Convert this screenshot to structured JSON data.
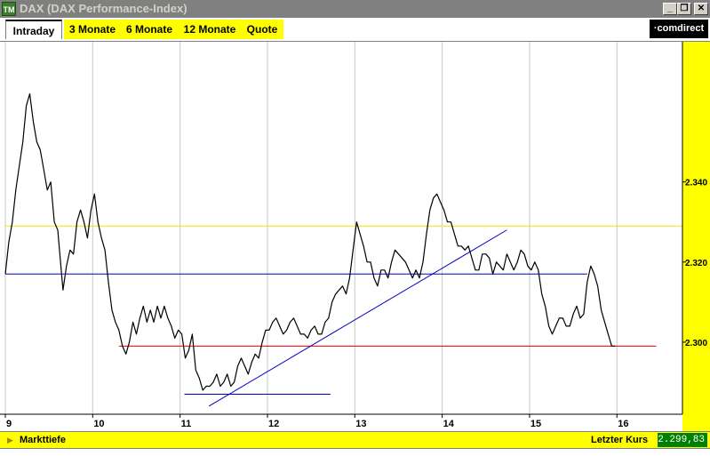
{
  "window": {
    "icon_text": "TM",
    "title": "DAX (DAX Performance-Index)",
    "buttons": {
      "minimize": "_",
      "restore": "❐",
      "close": "✕"
    }
  },
  "tabs": [
    {
      "label": "Intraday",
      "active": true
    },
    {
      "label": "3 Monate",
      "active": false
    },
    {
      "label": "6 Monate",
      "active": false
    },
    {
      "label": "12 Monate",
      "active": false
    },
    {
      "label": "Quote",
      "active": false
    }
  ],
  "logo": {
    "text": "comdirect"
  },
  "bottom": {
    "markttiefe_label": "Markttiefe",
    "letzter_kurs_label": "Letzter Kurs",
    "letzter_kurs_value": "2.299,83"
  },
  "colors": {
    "accent_yellow": "#ffff00",
    "price_line": "#000000",
    "blue_line": "#0000c0",
    "red_line": "#e00000",
    "yellow_line": "#e8e800",
    "value_bg": "#008000"
  },
  "chart_data": {
    "type": "line",
    "title": "",
    "xlabel": "",
    "ylabel": "",
    "x_ticks": [
      "9",
      "10",
      "11",
      "12",
      "13",
      "14",
      "15",
      "16"
    ],
    "x_tick_values": [
      9,
      10,
      11,
      12,
      13,
      14,
      15,
      16
    ],
    "y_ticks": [
      "2.340",
      "2.320",
      "2.300"
    ],
    "y_tick_values": [
      2340,
      2320,
      2300
    ],
    "xlim": [
      9.0,
      16.75
    ],
    "ylim": [
      2282,
      2375
    ],
    "grid": true,
    "series": [
      {
        "x": [
          9.0,
          9.04,
          9.08,
          9.12,
          9.16,
          9.2,
          9.24,
          9.28,
          9.32,
          9.36,
          9.4,
          9.44,
          9.48,
          9.52,
          9.56,
          9.6,
          9.64,
          9.66,
          9.7,
          9.74,
          9.78,
          9.82,
          9.86,
          9.9,
          9.94,
          9.98,
          10.02,
          10.06,
          10.1,
          10.14,
          10.18,
          10.22,
          10.26,
          10.3,
          10.34,
          10.38,
          10.42,
          10.46,
          10.5,
          10.54,
          10.58,
          10.62,
          10.66,
          10.7,
          10.74,
          10.78,
          10.82,
          10.86,
          10.9,
          10.94,
          10.98,
          11.02,
          11.06,
          11.1,
          11.14,
          11.18,
          11.22,
          11.26,
          11.3,
          11.34,
          11.38,
          11.42,
          11.46,
          11.5,
          11.54,
          11.58,
          11.62,
          11.66,
          11.7,
          11.74,
          11.78,
          11.82,
          11.86,
          11.9,
          11.94,
          11.98,
          12.02,
          12.06,
          12.1,
          12.14,
          12.18,
          12.22,
          12.26,
          12.3,
          12.34,
          12.38,
          12.42,
          12.46,
          12.5,
          12.54,
          12.58,
          12.62,
          12.66,
          12.7,
          12.74,
          12.78,
          12.82,
          12.86,
          12.9,
          12.94,
          12.98,
          13.02,
          13.06,
          13.1,
          13.14,
          13.18,
          13.22,
          13.26,
          13.3,
          13.34,
          13.38,
          13.42,
          13.46,
          13.5,
          13.54,
          13.58,
          13.62,
          13.66,
          13.7,
          13.74,
          13.78,
          13.82,
          13.86,
          13.9,
          13.94,
          13.98,
          14.02,
          14.06,
          14.1,
          14.14,
          14.18,
          14.22,
          14.26,
          14.3,
          14.34,
          14.38,
          14.42,
          14.46,
          14.5,
          14.54,
          14.58,
          14.62,
          14.66,
          14.7,
          14.74,
          14.78,
          14.82,
          14.86,
          14.9,
          14.94,
          14.98,
          15.02,
          15.06,
          15.1,
          15.14,
          15.18,
          15.22,
          15.26,
          15.3,
          15.34,
          15.38,
          15.42,
          15.46,
          15.5,
          15.54,
          15.58,
          15.62,
          15.66,
          15.7,
          15.74,
          15.78,
          15.82,
          15.86,
          15.9,
          15.94,
          15.98
        ],
        "values": [
          2317,
          2325,
          2330,
          2338,
          2344,
          2350,
          2359,
          2362,
          2355,
          2350,
          2348,
          2343,
          2338,
          2340,
          2330,
          2328,
          2318,
          2313,
          2319,
          2323,
          2322,
          2330,
          2333,
          2330,
          2326,
          2333,
          2337,
          2330,
          2326,
          2323,
          2315,
          2308,
          2305,
          2303,
          2299,
          2297,
          2300,
          2305,
          2302,
          2306,
          2309,
          2305,
          2308,
          2305,
          2309,
          2306,
          2309,
          2306,
          2304,
          2301,
          2303,
          2302,
          2296,
          2298,
          2302,
          2293,
          2291,
          2288,
          2289,
          2289,
          2290,
          2292,
          2289,
          2290,
          2292,
          2289,
          2290,
          2294,
          2296,
          2294,
          2292,
          2295,
          2297,
          2296,
          2300,
          2303,
          2303,
          2305,
          2306,
          2304,
          2302,
          2303,
          2305,
          2306,
          2304,
          2302,
          2302,
          2301,
          2303,
          2304,
          2302,
          2302,
          2305,
          2306,
          2310,
          2312,
          2313,
          2314,
          2312,
          2316,
          2323,
          2330,
          2327,
          2324,
          2320,
          2320,
          2316,
          2314,
          2318,
          2318,
          2316,
          2320,
          2323,
          2322,
          2321,
          2320,
          2318,
          2316,
          2318,
          2316,
          2320,
          2327,
          2333,
          2336,
          2337,
          2335,
          2333,
          2330,
          2330,
          2327,
          2324,
          2324,
          2323,
          2324,
          2321,
          2318,
          2318,
          2322,
          2322,
          2321,
          2317,
          2320,
          2319,
          2318,
          2322,
          2320,
          2318,
          2320,
          2323,
          2322,
          2319,
          2318,
          2320,
          2318,
          2312,
          2309,
          2304,
          2302,
          2304,
          2306,
          2306,
          2304,
          2304,
          2307,
          2309,
          2306,
          2307,
          2315,
          2319,
          2317,
          2314,
          2308,
          2305,
          2302,
          2299,
          2299
        ]
      }
    ],
    "reference_lines": [
      {
        "kind": "horizontal",
        "y": 2329,
        "color": "yellow"
      },
      {
        "kind": "horizontal",
        "y": 2317,
        "color": "blue"
      },
      {
        "kind": "horizontal",
        "y": 2299,
        "color": "red"
      },
      {
        "kind": "horizontal",
        "y": 2287,
        "color": "blue"
      }
    ],
    "trend_line": {
      "x": [
        11.33,
        14.74
      ],
      "y": [
        2284,
        2328
      ],
      "color": "blue"
    }
  }
}
